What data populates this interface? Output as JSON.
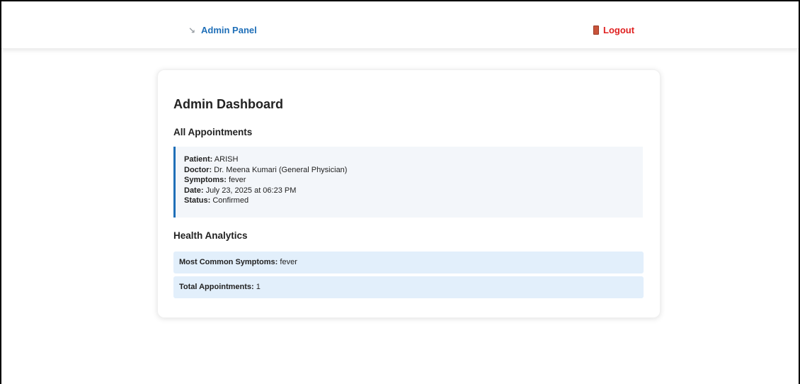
{
  "navbar": {
    "brand_icon": "wrench-icon",
    "brand_label": "Admin Panel",
    "logout_icon": "door-icon",
    "logout_label": "Logout"
  },
  "dashboard": {
    "title": "Admin Dashboard",
    "appointments_heading": "All Appointments",
    "appointment": {
      "patient_label": "Patient:",
      "patient_value": "ARISH",
      "doctor_label": "Doctor:",
      "doctor_value": "Dr. Meena Kumari (General Physician)",
      "symptoms_label": "Symptoms:",
      "symptoms_value": "fever",
      "date_label": "Date:",
      "date_value": "July 23, 2025 at 06:23 PM",
      "status_label": "Status:",
      "status_value": "Confirmed"
    },
    "analytics_heading": "Health Analytics",
    "common_symptoms_label": "Most Common Symptoms:",
    "common_symptoms_value": "fever",
    "total_label": "Total Appointments:",
    "total_value": "1"
  },
  "colors": {
    "brand": "#1f6fb8",
    "logout": "#e02020",
    "appointment_bg": "#f3f6fa",
    "stat_bg": "#e2effb"
  }
}
